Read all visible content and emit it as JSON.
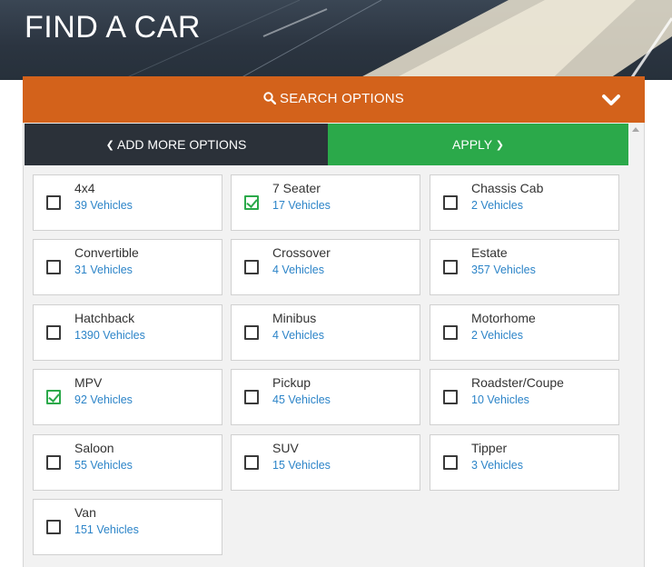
{
  "hero": {
    "title": "FIND A CAR"
  },
  "search_bar": {
    "label": "SEARCH OPTIONS"
  },
  "actions": {
    "add_more_label": "ADD MORE OPTIONS",
    "apply_label": "APPLY"
  },
  "icons": {
    "search": "magnifier-icon",
    "collapse": "chevron-down-icon",
    "left": "chevron-left-icon",
    "right": "chevron-right-icon"
  },
  "colors": {
    "accent_orange": "#d3621b",
    "apply_green": "#2ba94a",
    "dark_button": "#2b3139",
    "link_blue": "#2c84c8"
  },
  "body_types": [
    {
      "name": "4x4",
      "count": "39 Vehicles",
      "checked": false
    },
    {
      "name": "7 Seater",
      "count": "17 Vehicles",
      "checked": true
    },
    {
      "name": "Chassis Cab",
      "count": "2 Vehicles",
      "checked": false
    },
    {
      "name": "Convertible",
      "count": "31 Vehicles",
      "checked": false
    },
    {
      "name": "Crossover",
      "count": "4 Vehicles",
      "checked": false
    },
    {
      "name": "Estate",
      "count": "357 Vehicles",
      "checked": false
    },
    {
      "name": "Hatchback",
      "count": "1390 Vehicles",
      "checked": false
    },
    {
      "name": "Minibus",
      "count": "4 Vehicles",
      "checked": false
    },
    {
      "name": "Motorhome",
      "count": "2 Vehicles",
      "checked": false
    },
    {
      "name": "MPV",
      "count": "92 Vehicles",
      "checked": true
    },
    {
      "name": "Pickup",
      "count": "45 Vehicles",
      "checked": false
    },
    {
      "name": "Roadster/Coupe",
      "count": "10 Vehicles",
      "checked": false
    },
    {
      "name": "Saloon",
      "count": "55 Vehicles",
      "checked": false
    },
    {
      "name": "SUV",
      "count": "15 Vehicles",
      "checked": false
    },
    {
      "name": "Tipper",
      "count": "3 Vehicles",
      "checked": false
    },
    {
      "name": "Van",
      "count": "151 Vehicles",
      "checked": false
    }
  ]
}
